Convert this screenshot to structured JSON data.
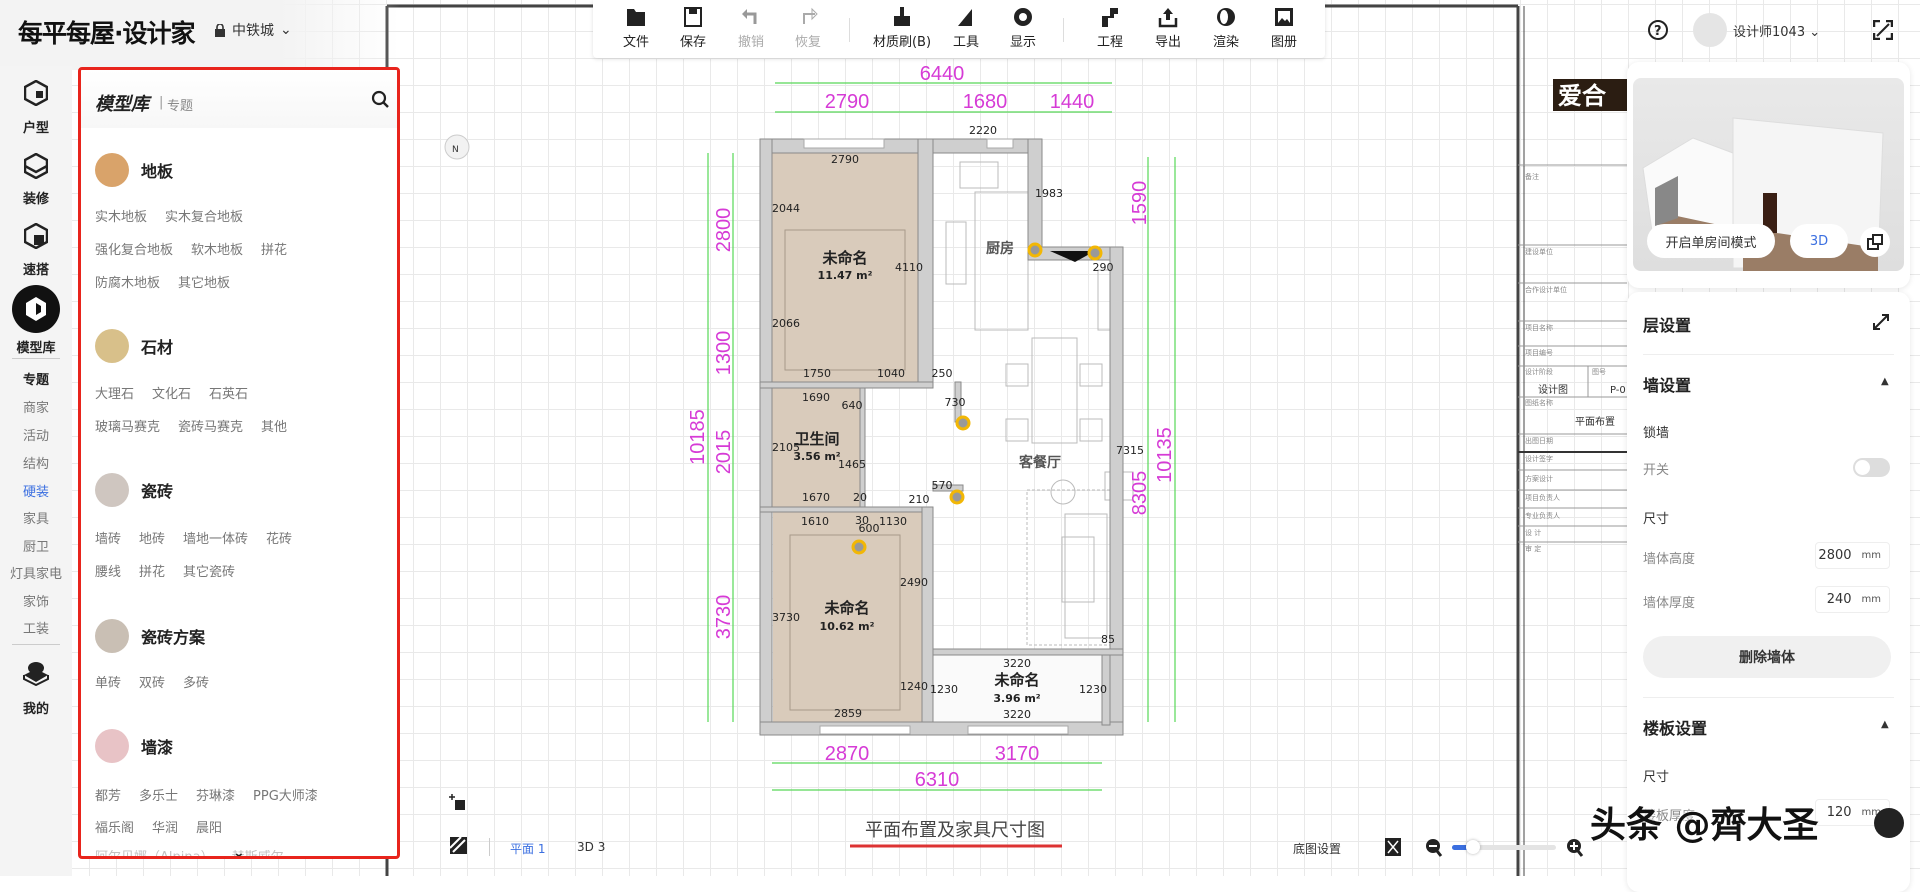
{
  "app": {
    "logo": "每平每屋·设计家",
    "project": "中铁城"
  },
  "toolbar": [
    {
      "label": "文件",
      "icon": "folder-icon"
    },
    {
      "label": "保存",
      "icon": "save-icon"
    },
    {
      "label": "撤销",
      "icon": "undo-icon"
    },
    {
      "label": "恢复",
      "icon": "redo-icon"
    },
    {
      "label": "材质刷(B)",
      "icon": "brush-icon"
    },
    {
      "label": "工具",
      "icon": "ruler-icon"
    },
    {
      "label": "显示",
      "icon": "eye-icon"
    },
    {
      "label": "工程",
      "icon": "engineering-icon"
    },
    {
      "label": "导出",
      "icon": "export-icon"
    },
    {
      "label": "渲染",
      "icon": "render-icon"
    },
    {
      "label": "图册",
      "icon": "album-icon"
    }
  ],
  "user": {
    "name": "设计师1043"
  },
  "rail": {
    "main": [
      "户型",
      "装修",
      "速搭",
      "模型库"
    ],
    "sub": [
      "专题",
      "商家",
      "活动",
      "结构",
      "硬装",
      "家具",
      "厨卫",
      "灯具家电",
      "家饰",
      "工装"
    ],
    "active_sub": "硬装",
    "mine": "我的"
  },
  "panel": {
    "title": "模型库",
    "subtitle": "专题",
    "categories": [
      {
        "name": "地板",
        "color": "#d9a36a",
        "rows": [
          [
            "实木地板",
            "实木复合地板"
          ],
          [
            "强化复合地板",
            "软木地板",
            "拼花"
          ],
          [
            "防腐木地板",
            "其它地板"
          ]
        ]
      },
      {
        "name": "石材",
        "color": "#d8c08a",
        "rows": [
          [
            "大理石",
            "文化石",
            "石英石"
          ],
          [
            "玻璃马赛克",
            "瓷砖马赛克",
            "其他"
          ]
        ]
      },
      {
        "name": "瓷砖",
        "color": "#cfc6c0",
        "rows": [
          [
            "墙砖",
            "地砖",
            "墙地一体砖",
            "花砖"
          ],
          [
            "腰线",
            "拼花",
            "其它瓷砖"
          ]
        ]
      },
      {
        "name": "瓷砖方案",
        "color": "#c9bfb4",
        "rows": [
          [
            "单砖",
            "双砖",
            "多砖"
          ]
        ]
      },
      {
        "name": "墙漆",
        "color": "#e8c3c6",
        "rows": [
          [
            "都芳",
            "多乐士",
            "芬琳漆",
            "PPG大师漆"
          ],
          [
            "福乐阁",
            "华润",
            "晨阳"
          ],
          [
            "阿尔贝娜（Alpina）",
            "赫斯威尔"
          ]
        ]
      }
    ]
  },
  "preview": {
    "single_room": "开启单房间模式",
    "mode": "3D"
  },
  "settings": {
    "layer": "层设置",
    "wall": "墙设置",
    "lock_wall": "锁墙",
    "switch": "开关",
    "switch_on": false,
    "size": "尺寸",
    "wall_height_label": "墙体高度",
    "wall_height": "2800",
    "wall_thickness_label": "墙体厚度",
    "wall_thickness": "240",
    "unit": "mm",
    "delete_wall": "删除墙体",
    "slab": "楼板设置",
    "slab_size": "尺寸",
    "slab_thickness_label": "楼板厚度",
    "slab_thickness": "120"
  },
  "plan": {
    "title": "平面布置及家具尺寸图",
    "compass": "N",
    "rooms": [
      {
        "name": "未命名",
        "area": "11.47 m²"
      },
      {
        "name": "厨房"
      },
      {
        "name": "卫生间",
        "area": "3.56 m²"
      },
      {
        "name": "客餐厅"
      },
      {
        "name": "未命名",
        "area": "10.62 m²"
      },
      {
        "name": "未命名",
        "area": "3.96 m²"
      }
    ],
    "outer_dims": [
      "6440",
      "2790",
      "1680",
      "1440",
      "2800",
      "1300",
      "2015",
      "10185",
      "3730",
      "1590",
      "10135",
      "8305",
      "2870",
      "3170",
      "6310"
    ],
    "inner_dims": [
      "2220",
      "2790",
      "1983",
      "2044",
      "4110",
      "2066",
      "1750",
      "1040",
      "250",
      "1690",
      "640",
      "730",
      "2105",
      "1465",
      "290",
      "7315",
      "1670",
      "20",
      "210",
      "570",
      "1610",
      "30",
      "1130",
      "600",
      "2490",
      "3730",
      "1240",
      "1230",
      "3220",
      "1230",
      "3220",
      "2859",
      "85"
    ],
    "title_block": {
      "logo": "爱合",
      "fields": [
        "备注",
        "建设单位",
        "合作设计单位",
        "项目名称",
        "项目编号",
        "设计阶段",
        "设计图",
        "图号",
        "P-0",
        "图纸名称",
        "平面布置",
        "出图日期",
        "设计签字",
        "方案设计",
        "项目负责人",
        "专业负责人",
        "设 计",
        "审 定"
      ]
    }
  },
  "bottom": {
    "plan_tab": "平面 1",
    "tab_3d": "3D 3",
    "base_map": "底图设置",
    "zoom_level": 0.2
  },
  "watermark": "头条 @齊大圣",
  "colors": {
    "accent": "#3b6fe0",
    "highlight": "#e8241c",
    "dimension": "#d63bd6",
    "dim_line": "#58d858",
    "handle": "#f2b705"
  }
}
